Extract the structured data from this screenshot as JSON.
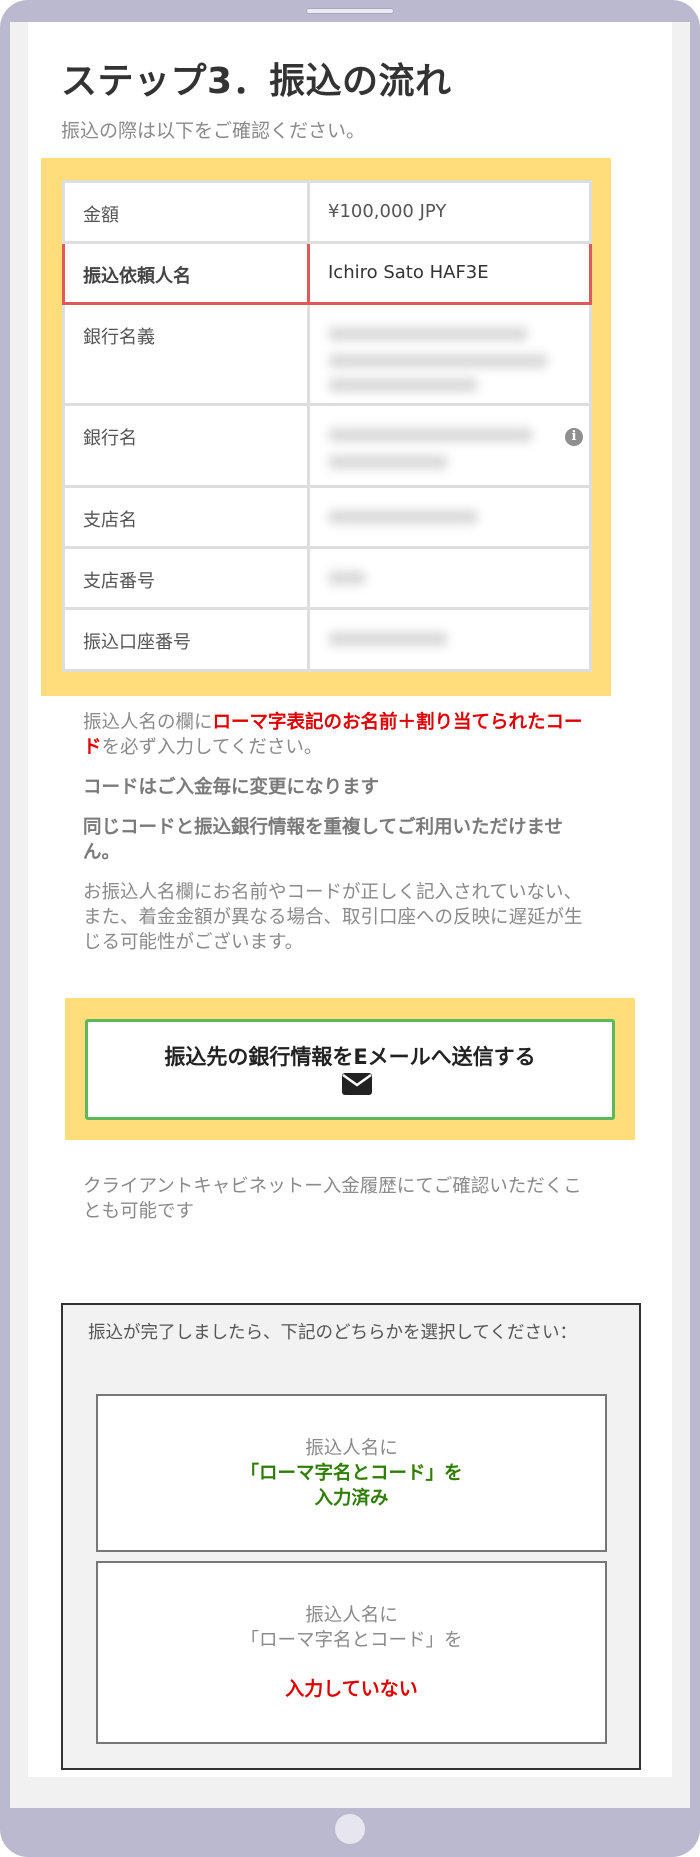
{
  "header": {
    "title": "ステップ3．振込の流れ",
    "subtitle": "振込の際は以下をご確認ください。"
  },
  "bank_table": {
    "rows": [
      {
        "label": "金額",
        "value": "¥100,000 JPY"
      },
      {
        "label": "振込依頼人名",
        "value": "Ichiro Sato HAF3E"
      },
      {
        "label": "銀行名義",
        "value": ""
      },
      {
        "label": "銀行名",
        "value": ""
      },
      {
        "label": "支店名",
        "value": ""
      },
      {
        "label": "支店番号",
        "value": ""
      },
      {
        "label": "振込口座番号",
        "value": ""
      }
    ],
    "info_icon": "info-icon"
  },
  "notes": {
    "remitter_prefix": "振込人名の欄に",
    "remitter_emphasis": "ローマ字表記のお名前＋割り当てられたコード",
    "remitter_suffix": "を必ず入力してください。",
    "code_changes": "コードはご入金毎に変更になります",
    "no_reuse": "同じコードと振込銀行情報を重複してご利用いただけません。",
    "delay_warning": "お振込人名欄にお名前やコードが正しく記入されていない、また、着金金額が異なる場合、取引口座への反映に遅延が生じる可能性がございます。"
  },
  "email_button": {
    "label": "振込先の銀行情報をEメールへ送信する",
    "icon": "envelope-icon"
  },
  "cabinet_note": "クライアントキャビネットー入金履歴にてご確認いただくことも可能です",
  "choice": {
    "prompt": "振込が完了しましたら、下記のどちらかを選択してください：",
    "option_entered": {
      "line1": "振込人名に",
      "line2": "「ローマ字名とコード」を",
      "line3": "入力済み"
    },
    "option_not_entered": {
      "line1": "振込人名に",
      "line2": "「ローマ字名とコード」を",
      "line3": "入力していない"
    }
  },
  "colors": {
    "highlight": "#fedd7a",
    "alert_red": "#e00000",
    "success_green": "#2e7d00",
    "email_border": "#5cb85c",
    "device_frame": "#bbb9cf"
  }
}
